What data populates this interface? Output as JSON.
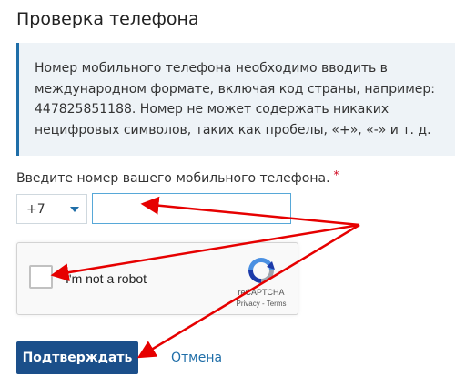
{
  "page": {
    "title": "Проверка телефона"
  },
  "notice": {
    "text": "Номер мобильного телефона необходимо вводить в международном формате, включая код страны, например: 447825851188. Номер не может содержать никаких нецифровых символов, таких как пробелы, «+», «-» и т. д."
  },
  "form": {
    "phone_label": "Введите номер вашего мобильного телефона.",
    "required_mark": "*",
    "country_code": "+7",
    "phone_value": "",
    "phone_placeholder": ""
  },
  "recaptcha": {
    "label": "I'm not a robot",
    "brand": "reCAPTCHA",
    "links": "Privacy - Terms"
  },
  "actions": {
    "submit_label": "Подтверждать",
    "cancel_label": "Отмена"
  },
  "colors": {
    "primary": "#1b4f8a",
    "link": "#1f6ea8",
    "notice_bg": "#eef3f7",
    "annotation_arrow": "#e60000"
  }
}
